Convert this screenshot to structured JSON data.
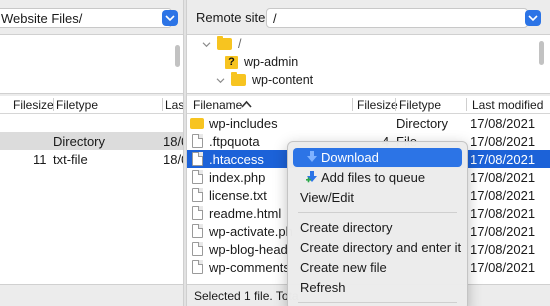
{
  "local": {
    "site_label": "Website Files/",
    "columns": [
      "Filesize",
      "Filetype",
      "Las"
    ],
    "rows": [
      {
        "size": "",
        "type": "Directory",
        "modified": "18/0"
      },
      {
        "size": "11",
        "type": "txt-file",
        "modified": "18/0"
      }
    ]
  },
  "remote": {
    "site_label": "Remote site:",
    "site_value": "/",
    "tree": [
      {
        "label": "/",
        "icon": "folder-icon"
      },
      {
        "label": "wp-admin",
        "icon": "question-icon"
      },
      {
        "label": "wp-content",
        "icon": "folder-icon"
      }
    ],
    "columns": {
      "filename": "Filename",
      "filesize": "Filesize",
      "filetype": "Filetype",
      "modified": "Last modified"
    },
    "files": [
      {
        "name": "wp-includes",
        "size": "",
        "type": "Directory",
        "modified": "17/08/2021",
        "icon": "folder-icon"
      },
      {
        "name": ".ftpquota",
        "size": "4",
        "type": "File",
        "modified": "17/08/2021",
        "icon": "file-icon"
      },
      {
        "name": ".htaccess",
        "size": "",
        "type": "",
        "modified": "17/08/2021",
        "icon": "file-icon"
      },
      {
        "name": "index.php",
        "size": "",
        "type": "",
        "modified": "17/08/2021",
        "icon": "file-icon"
      },
      {
        "name": "license.txt",
        "size": "",
        "type": "",
        "modified": "17/08/2021",
        "icon": "file-icon"
      },
      {
        "name": "readme.html",
        "size": "",
        "type": "",
        "modified": "17/08/2021",
        "icon": "file-icon"
      },
      {
        "name": "wp-activate.ph",
        "size": "",
        "type": "",
        "modified": "17/08/2021",
        "icon": "file-icon"
      },
      {
        "name": "wp-blog-head",
        "size": "",
        "type": "",
        "modified": "17/08/2021",
        "icon": "file-icon"
      },
      {
        "name": "wp-comments",
        "size": "",
        "type": "",
        "modified": "17/08/2021",
        "icon": "file-icon"
      }
    ],
    "status": "Selected 1 file. Tota"
  },
  "context_menu": {
    "download": "Download",
    "add_to_queue": "Add files to queue",
    "view_edit": "View/Edit",
    "create_directory": "Create directory",
    "create_directory_enter": "Create directory and enter it",
    "create_new_file": "Create new file",
    "refresh": "Refresh"
  },
  "colors": {
    "accent": "#2c74e6",
    "selection": "#1c62d8",
    "folder": "#f7c420"
  }
}
